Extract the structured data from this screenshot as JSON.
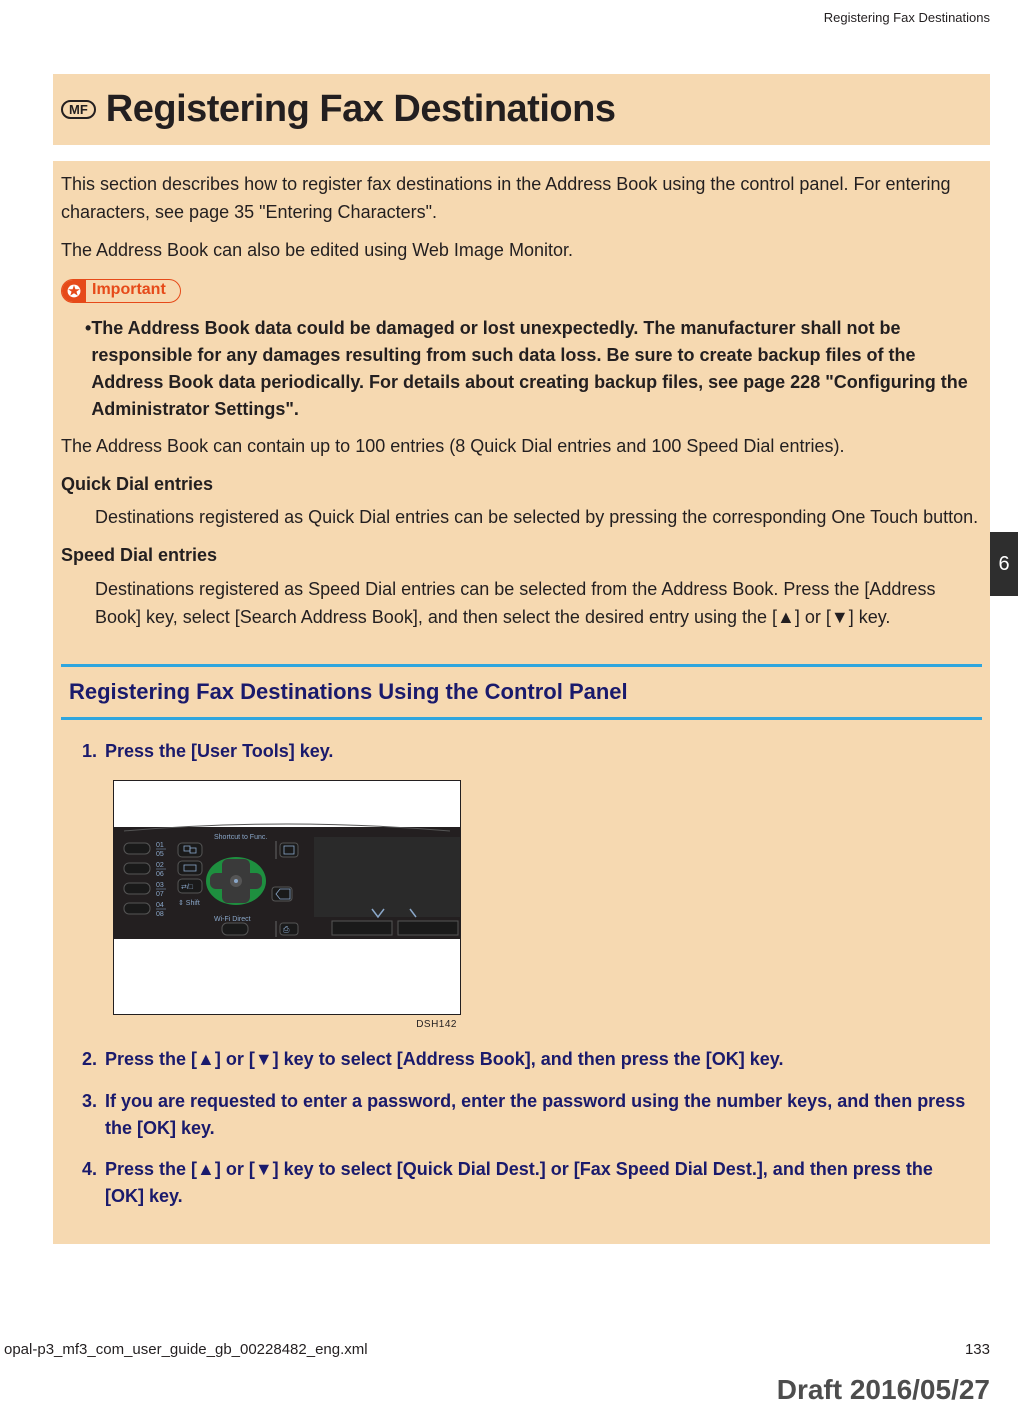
{
  "running_head": "Registering Fax Destinations",
  "badge": "MF",
  "title": "Registering Fax Destinations",
  "intro_p1": "This section describes how to register fax destinations in the Address Book using the control panel. For entering characters, see page 35 \"Entering Characters\".",
  "intro_p2": "The Address Book can also be edited using Web Image Monitor.",
  "important_label": "Important",
  "important_bullet": "The Address Book data could be damaged or lost unexpectedly. The manufacturer shall not be responsible for any damages resulting from such data loss. Be sure to create backup files of the Address Book data periodically. For details about creating backup files, see page 228 \"Configuring the Administrator Settings\".",
  "capacity": "The Address Book can contain up to 100 entries (8 Quick Dial entries and 100 Speed Dial entries).",
  "quick_term": "Quick Dial entries",
  "quick_body": "Destinations registered as Quick Dial entries can be selected by pressing the corresponding One Touch button.",
  "speed_term": "Speed Dial entries",
  "speed_body": "Destinations registered as Speed Dial entries can be selected from the Address Book. Press the [Address Book] key, select [Search Address Book], and then select the desired entry using the [▲] or [▼] key.",
  "h2": "Registering Fax Destinations Using the Control Panel",
  "steps": {
    "s1": "Press the [User Tools] key.",
    "s2": "Press the [▲] or [▼] key to select [Address Book], and then press the [OK] key.",
    "s3": "If you are requested to enter a password, enter the password using the number keys, and then press the [OK] key.",
    "s4": "Press the [▲] or [▼] key to select [Quick Dial Dest.] or [Fax Speed Dial Dest.], and then press the [OK] key."
  },
  "figure_code": "DSH142",
  "panel_labels": {
    "rows": [
      "01",
      "05",
      "02",
      "06",
      "03",
      "07",
      "04",
      "08"
    ],
    "shortcut": "Shortcut to Func.",
    "shift": "Shift",
    "wifi": "Wi-Fi Direct"
  },
  "chapter_tab": "6",
  "footer_file": "opal-p3_mf3_com_user_guide_gb_00228482_eng.xml",
  "page_number": "133",
  "draft_stamp": "Draft 2016/05/27"
}
